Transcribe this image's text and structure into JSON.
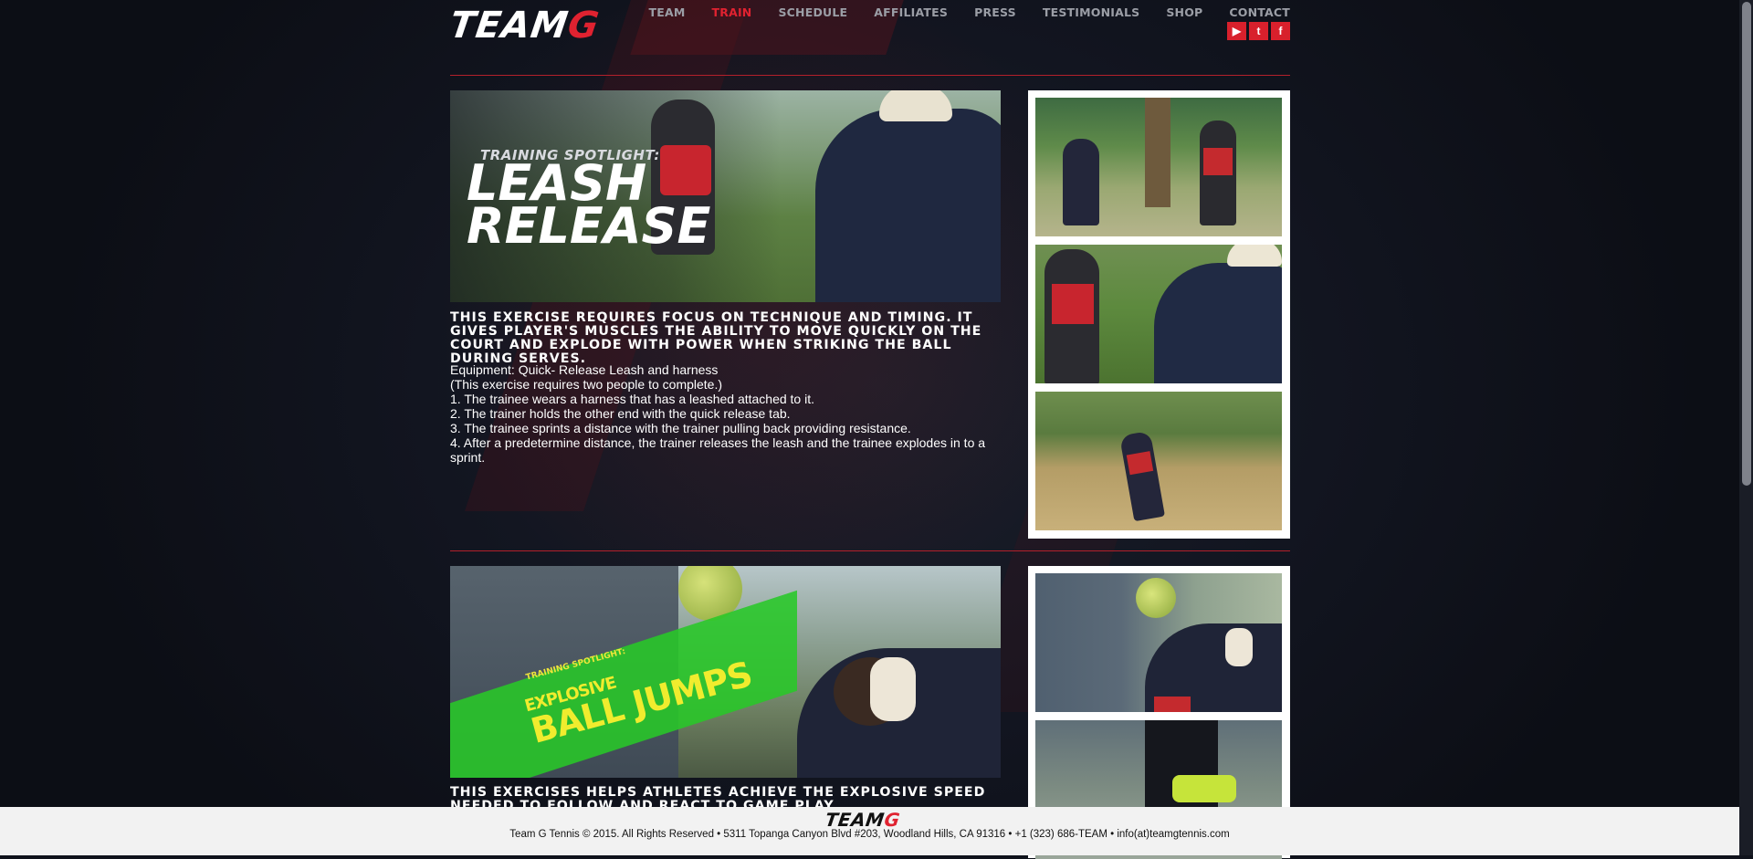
{
  "brand": {
    "logo_main": "TEAM",
    "logo_accent": "G",
    "accent_color": "#e02230"
  },
  "nav": {
    "items": [
      "TEAM",
      "TRAIN",
      "SCHEDULE",
      "AFFILIATES",
      "PRESS",
      "TESTIMONIALS",
      "SHOP",
      "CONTACT"
    ],
    "active": "TRAIN"
  },
  "social": {
    "youtube_glyph": "▶",
    "twitter_glyph": "t",
    "facebook_glyph": "f",
    "icons": [
      "youtube-icon",
      "twitter-icon",
      "facebook-icon"
    ]
  },
  "exercise1": {
    "hero_kicker": "TRAINING SPOTLIGHT:",
    "hero_title": "LEASH RELEASE",
    "lead": "THIS EXERCISE REQUIRES FOCUS ON TECHNIQUE AND TIMING. IT GIVES PLAYER'S MUSCLES THE ABILITY TO MOVE QUICKLY ON THE COURT AND EXPLODE WITH POWER WHEN STRIKING THE BALL DURING SERVES.",
    "equipment": "Equipment: Quick- Release Leash and harness",
    "note": "(This exercise requires two people to complete.)",
    "steps": [
      "1. The trainee wears a harness that has a leashed attached to it.",
      "2. The trainer holds the other end with the quick release tab.",
      "3. The trainee sprints a distance with the trainer pulling back providing resistance.",
      "4. After a predetermine distance, the trainer releases the leash and the trainee explodes in to a sprint."
    ]
  },
  "exercise2": {
    "hero_kicker": "TRAINING SPOTLIGHT:",
    "hero_title_part1": "EXPLOSIVE",
    "hero_title_part2": "BALL JUMPS",
    "lead": "THIS EXERCISES HELPS ATHLETES ACHIEVE THE EXPLOSIVE SPEED NEEDED TO FOLLOW AND REACT TO GAME PLAY."
  },
  "footer": {
    "logo_main": "TEAM",
    "logo_accent": "G",
    "text": "Team G Tennis © 2015. All Rights Reserved • 5311 Topanga Canyon Blvd #203, Woodland Hills, CA 91316 • +1 (323) 686-TEAM • info(at)teamgtennis.com"
  }
}
